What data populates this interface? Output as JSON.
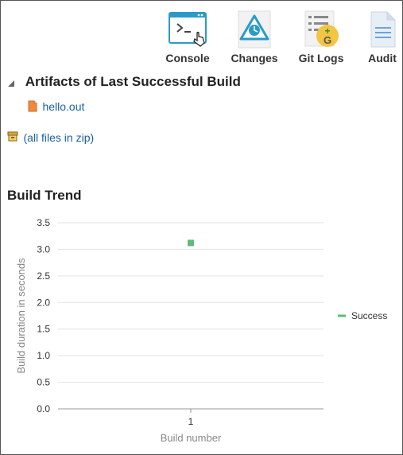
{
  "toolbar": {
    "items": [
      {
        "label": "Console",
        "icon": "console-icon"
      },
      {
        "label": "Changes",
        "icon": "changes-icon"
      },
      {
        "label": "Git Logs",
        "icon": "git-logs-icon"
      },
      {
        "label": "Audit",
        "icon": "audit-icon"
      }
    ]
  },
  "artifacts": {
    "title": "Artifacts of Last Successful Build",
    "files": [
      "hello.out"
    ],
    "zip_link": "(all files in zip)"
  },
  "trend": {
    "title": "Build Trend"
  },
  "colors": {
    "link": "#1b5fa8",
    "success": "#5bbd78",
    "accent": "#2a9bc7"
  },
  "chart_data": {
    "type": "scatter",
    "title": "Build Trend",
    "xlabel": "Build number",
    "ylabel": "Build duration in seconds",
    "x_categories": [
      "1"
    ],
    "ylim": [
      0,
      3.5
    ],
    "yticks": [
      "0.0",
      "0.5",
      "1.0",
      "1.5",
      "2.0",
      "2.5",
      "3.0",
      "3.5"
    ],
    "grid": true,
    "legend_position": "right",
    "series": [
      {
        "name": "Success",
        "color": "#5bbd78",
        "points": [
          {
            "x": "1",
            "y": 3.12
          }
        ]
      }
    ]
  }
}
